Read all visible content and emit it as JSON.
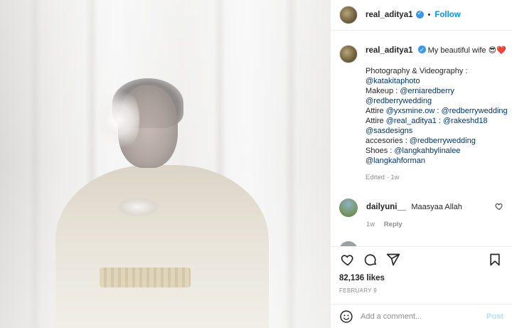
{
  "header": {
    "username": "real_aditya1",
    "separator": "•",
    "follow_label": "Follow"
  },
  "caption": {
    "username": "real_aditya1",
    "text": "My beautiful wife 😎❤️",
    "lines": [
      {
        "parts": [
          {
            "t": "Photography & Videography :",
            "m": false
          }
        ]
      },
      {
        "parts": [
          {
            "t": "@katakitaphoto",
            "m": true
          }
        ]
      },
      {
        "parts": [
          {
            "t": "Makeup : ",
            "m": false
          },
          {
            "t": "@erniaredberry",
            "m": true
          }
        ]
      },
      {
        "parts": [
          {
            "t": "@redberrywedding",
            "m": true
          }
        ]
      },
      {
        "parts": [
          {
            "t": "Attire ",
            "m": false
          },
          {
            "t": "@yxsmine.ow",
            "m": true
          },
          {
            "t": " : ",
            "m": false
          },
          {
            "t": "@redberrywedding",
            "m": true
          }
        ]
      },
      {
        "parts": [
          {
            "t": "Attire ",
            "m": false
          },
          {
            "t": "@real_aditya1",
            "m": true
          },
          {
            "t": " : ",
            "m": false
          },
          {
            "t": "@rakeshd18",
            "m": true
          }
        ]
      },
      {
        "parts": [
          {
            "t": "@sasdesigns",
            "m": true
          }
        ]
      },
      {
        "parts": [
          {
            "t": "accesories : ",
            "m": false
          },
          {
            "t": "@redberrywedding",
            "m": true
          }
        ]
      },
      {
        "parts": [
          {
            "t": "Shoes : ",
            "m": false
          },
          {
            "t": "@langkahbylinalee",
            "m": true
          }
        ]
      },
      {
        "parts": [
          {
            "t": "@langkahforman",
            "m": true
          }
        ]
      }
    ],
    "edited": "Edited · 1w"
  },
  "comments": [
    {
      "username": "dailyuni__",
      "text": "Maasyaa Allah",
      "time": "1w",
      "reply_label": "Reply"
    }
  ],
  "likes": "82,136 likes",
  "date": "FEBRUARY 9",
  "add_comment": {
    "placeholder": "Add a comment...",
    "post_label": "Post"
  },
  "colors": {
    "link": "#00376b",
    "accent": "#0095f6",
    "muted": "#8e8e8e",
    "verified": "#3897f0"
  },
  "icons": [
    "heart-icon",
    "comment-icon",
    "share-icon",
    "bookmark-icon",
    "emoji-icon",
    "verified-badge-icon"
  ]
}
